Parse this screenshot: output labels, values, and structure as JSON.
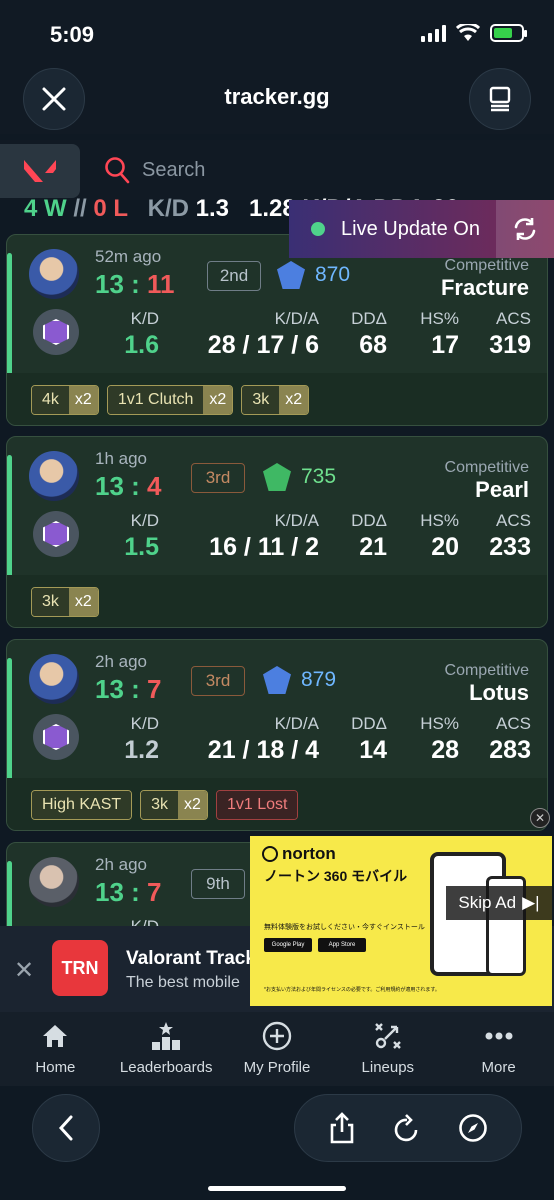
{
  "status": {
    "time": "5:09"
  },
  "header": {
    "title": "tracker.gg"
  },
  "search": {
    "placeholder": "Search"
  },
  "summary": {
    "wins": "4 W",
    "sep": " // ",
    "losses": "0 L",
    "kd_label": "K/D",
    "kd_value": "1.3",
    "extra": "1.28 K/D/A  DDΔ 26"
  },
  "live": {
    "label": "Live Update On"
  },
  "matches": [
    {
      "ago": "52m ago",
      "score_win": "13",
      "score_loss": "11",
      "colon": " : ",
      "place": "2nd",
      "rr": "870",
      "mode": "Competitive",
      "map": "Fracture",
      "kd_label": "K/D",
      "kd": "1.6",
      "kda_label": "K/D/A",
      "kda": "28 / 17 / 6",
      "dd_label": "DDΔ",
      "dd": "68",
      "hs_label": "HS%",
      "hs": "17",
      "acs_label": "ACS",
      "acs": "319",
      "chips": [
        {
          "name": "4k",
          "mult": "x2"
        },
        {
          "name": "1v1 Clutch",
          "mult": "x2"
        },
        {
          "name": "3k",
          "mult": "x2"
        }
      ]
    },
    {
      "ago": "1h ago",
      "score_win": "13",
      "score_loss": "4",
      "colon": " : ",
      "place": "3rd",
      "rr": "735",
      "mode": "Competitive",
      "map": "Pearl",
      "kd_label": "K/D",
      "kd": "1.5",
      "kda_label": "K/D/A",
      "kda": "16 / 11 / 2",
      "dd_label": "DDΔ",
      "dd": "21",
      "hs_label": "HS%",
      "hs": "20",
      "acs_label": "ACS",
      "acs": "233",
      "chips": [
        {
          "name": "3k",
          "mult": "x2"
        }
      ]
    },
    {
      "ago": "2h ago",
      "score_win": "13",
      "score_loss": "7",
      "colon": " : ",
      "place": "3rd",
      "rr": "879",
      "mode": "Competitive",
      "map": "Lotus",
      "kd_label": "K/D",
      "kd": "1.2",
      "kda_label": "K/D/A",
      "kda": "21 / 18 / 4",
      "dd_label": "DDΔ",
      "dd": "14",
      "hs_label": "HS%",
      "hs": "28",
      "acs_label": "ACS",
      "acs": "283",
      "chips": [
        {
          "name": "High KAST"
        },
        {
          "name": "3k",
          "mult": "x2"
        },
        {
          "name": "1v1 Lost"
        }
      ]
    },
    {
      "ago": "2h ago",
      "score_win": "13",
      "score_loss": "7",
      "colon": " : ",
      "place": "9th",
      "kd_label": "K/D"
    }
  ],
  "ad": {
    "title": "Valorant Track",
    "subtitle": "The best mobile",
    "logo_text": "TRN",
    "norton_brand": "norton",
    "norton_product": "ノートン 360 モバイル",
    "norton_small": "無料体験版をお試しください・今すぐインストール",
    "store_google": "Google Play",
    "store_apple": "App Store",
    "norton_fine": "*お支払い方法および年間ライセンスの必要です。ご利用規約が適用されます。",
    "skip_label": "Skip Ad"
  },
  "bottom_nav": [
    {
      "label": "Home",
      "icon": "home-icon"
    },
    {
      "label": "Leaderboards",
      "icon": "leaderboard-icon"
    },
    {
      "label": "My Profile",
      "icon": "add-circle-icon"
    },
    {
      "label": "Lineups",
      "icon": "lineups-icon"
    },
    {
      "label": "More",
      "icon": "more-icon"
    }
  ],
  "colors": {
    "win": "#4fd28b",
    "loss": "#f05a5a",
    "accent": "#e8373c",
    "rr_blue": "#6fb7ff"
  }
}
